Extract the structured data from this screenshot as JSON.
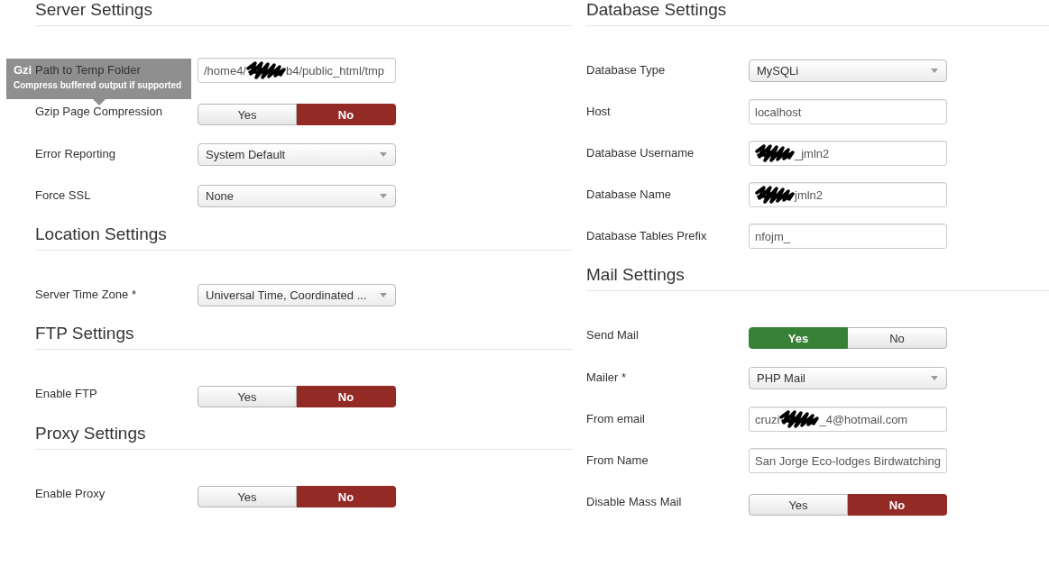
{
  "tooltip": {
    "title": "Gzi",
    "text": "Compress buffered output if supported"
  },
  "columns": [
    {
      "sections": [
        {
          "title": "Server Settings",
          "rows": [
            {
              "label": "Path to Temp Folder",
              "kind": "text",
              "parts": [
                {
                  "kind": "text",
                  "text": "/home4/"
                },
                {
                  "kind": "redaction"
                },
                {
                  "kind": "text",
                  "text": "b4/public_html/tmp"
                }
              ]
            },
            {
              "label": "Gzip Page Compression",
              "kind": "toggle",
              "options": [
                {
                  "label": "Yes",
                  "kind": "yes",
                  "selected": false
                },
                {
                  "label": "No",
                  "kind": "no",
                  "selected": true
                }
              ]
            },
            {
              "label": "Error Reporting",
              "kind": "select",
              "value": "System Default"
            },
            {
              "label": "Force SSL",
              "kind": "select",
              "value": "None"
            }
          ]
        },
        {
          "title": "Location Settings",
          "rows": [
            {
              "label": "Server Time Zone *",
              "kind": "select",
              "value": "Universal Time, Coordinated ..."
            }
          ]
        },
        {
          "title": "FTP Settings",
          "rows": [
            {
              "label": "Enable FTP",
              "kind": "toggle",
              "options": [
                {
                  "label": "Yes",
                  "kind": "yes",
                  "selected": false
                },
                {
                  "label": "No",
                  "kind": "no",
                  "selected": true
                }
              ]
            }
          ]
        },
        {
          "title": "Proxy Settings",
          "rows": [
            {
              "label": "Enable Proxy",
              "kind": "toggle",
              "options": [
                {
                  "label": "Yes",
                  "kind": "yes",
                  "selected": false
                },
                {
                  "label": "No",
                  "kind": "no",
                  "selected": true
                }
              ]
            }
          ]
        }
      ]
    },
    {
      "sections": [
        {
          "title": "Database Settings",
          "rows": [
            {
              "label": "Database Type",
              "kind": "select",
              "value": "MySQLi"
            },
            {
              "label": "Host",
              "kind": "text",
              "value": "localhost"
            },
            {
              "label": "Database Username",
              "kind": "text",
              "parts": [
                {
                  "kind": "redaction"
                },
                {
                  "kind": "text",
                  "text": "_jmln2"
                }
              ]
            },
            {
              "label": "Database Name",
              "kind": "text",
              "parts": [
                {
                  "kind": "redaction"
                },
                {
                  "kind": "text",
                  "text": "jmln2"
                }
              ]
            },
            {
              "label": "Database Tables Prefix",
              "kind": "text",
              "value": "nfojm_"
            }
          ]
        },
        {
          "title": "Mail Settings",
          "rows": [
            {
              "label": "Send Mail",
              "kind": "toggle",
              "options": [
                {
                  "label": "Yes",
                  "kind": "yes",
                  "selected": true
                },
                {
                  "label": "No",
                  "kind": "no",
                  "selected": false
                }
              ]
            },
            {
              "label": "Mailer *",
              "kind": "select",
              "value": "PHP Mail"
            },
            {
              "label": "From email",
              "kind": "text",
              "parts": [
                {
                  "kind": "text",
                  "text": "cruzi"
                },
                {
                  "kind": "redaction"
                },
                {
                  "kind": "text",
                  "text": "_4@hotmail.com"
                }
              ]
            },
            {
              "label": "From Name",
              "kind": "text",
              "value": "San Jorge Eco-lodges Birdwatching"
            },
            {
              "label": "Disable Mass Mail",
              "kind": "toggle",
              "options": [
                {
                  "label": "Yes",
                  "kind": "yes",
                  "selected": false
                },
                {
                  "label": "No",
                  "kind": "no",
                  "selected": true
                }
              ]
            }
          ]
        }
      ]
    }
  ]
}
